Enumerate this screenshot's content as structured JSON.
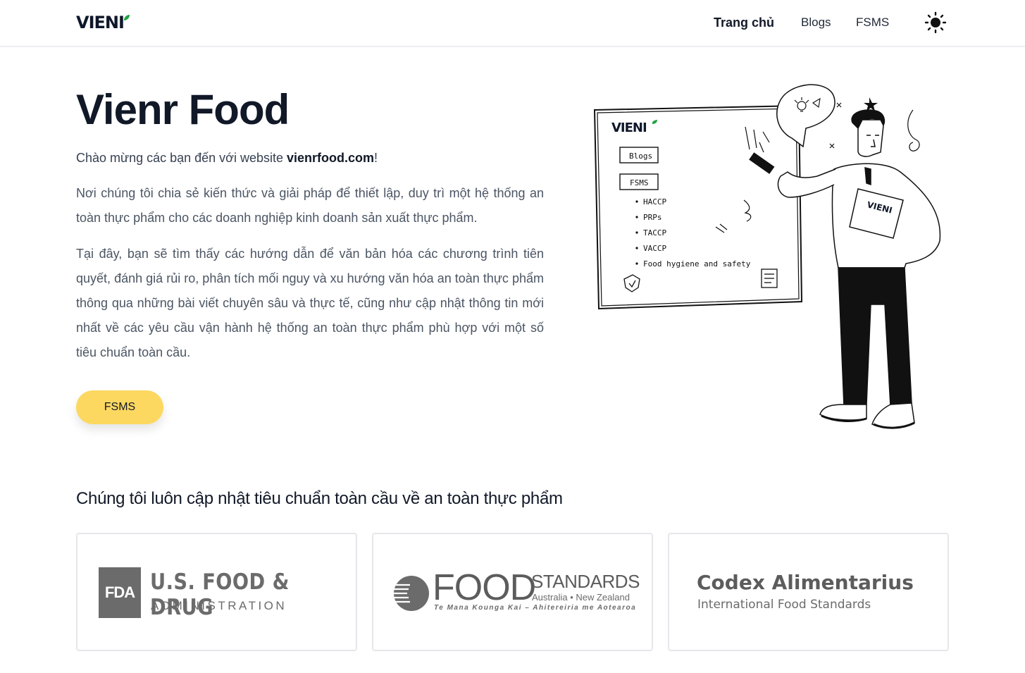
{
  "header": {
    "logo_text": "VIENI",
    "nav": [
      {
        "label": "Trang chủ",
        "active": true
      },
      {
        "label": "Blogs",
        "active": false
      },
      {
        "label": "FSMS",
        "active": false
      }
    ],
    "theme_icon": "sun-icon"
  },
  "hero": {
    "title": "Vienr Food",
    "welcome_prefix": "Chào mừng các bạn đến với website ",
    "welcome_site": "vienrfood.com",
    "welcome_suffix": "!",
    "para1": "Nơi chúng tôi chia sẻ kiến thức và giải pháp để thiết lập, duy trì một hệ thống an toàn thực phẩm cho các doanh nghiệp kinh doanh sản xuất thực phẩm.",
    "para2": "Tại đây, bạn sẽ tìm thấy các hướng dẫn để văn bản hóa các chương trình tiên quyết, đánh giá rủi ro, phân tích mối nguy và xu hướng văn hóa an toàn thực phẩm thông qua những bài viết chuyên sâu và thực tế, cũng như cập nhật thông tin mới nhất về các yêu cầu vận hành hệ thống an toàn thực phẩm phù hợp với một số tiêu chuẩn toàn cầu.",
    "cta_label": "FSMS"
  },
  "illustration": {
    "board_logo": "VIENI",
    "board_buttons": [
      "Blogs",
      "FSMS"
    ],
    "board_items": [
      "HACCP",
      "PRPs",
      "TACCP",
      "VACCP",
      "Food hygiene and safety"
    ],
    "clipboard_logo": "VIENI"
  },
  "partners": {
    "title": "Chúng tôi luôn cập nhật tiêu chuẩn toàn cầu về an toàn thực phẩm",
    "fda": {
      "box": "FDA",
      "main": "U.S. FOOD & DRUG",
      "sub": "ADMINISTRATION"
    },
    "fsanz": {
      "main": "FOOD",
      "standards": "STANDARDS",
      "region": "Australia • New Zealand",
      "tagline": "Te Mana Kounga Kai – Ahitereiria me Aotearoa"
    },
    "codex": {
      "main": "Codex Alimentarius",
      "sub": "International Food Standards"
    }
  },
  "colors": {
    "accent": "#fcd861",
    "leaf": "#22a344",
    "text_dark": "#111827",
    "logo_gray": "#6b6b6b"
  }
}
